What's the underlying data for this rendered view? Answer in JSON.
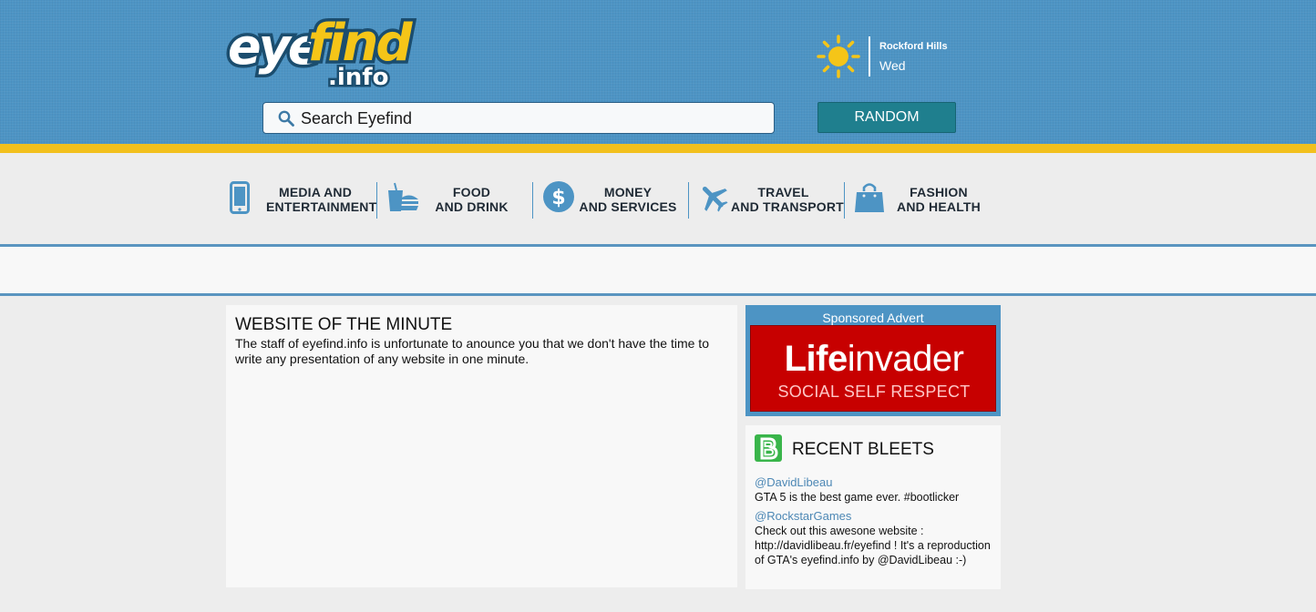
{
  "header": {
    "logo_alt": "eyefind.info",
    "weather": {
      "icon": "sun-icon",
      "city": "Rockford Hills",
      "day": "Wed"
    },
    "search": {
      "placeholder": "Search Eyefind",
      "value": ""
    },
    "random_label": "RANDOM"
  },
  "categories": [
    {
      "icon": "phone-icon",
      "line1": "MEDIA AND",
      "line2": "ENTERTAINMENT"
    },
    {
      "icon": "food-icon",
      "line1": "FOOD",
      "line2": "AND DRINK"
    },
    {
      "icon": "dollar-icon",
      "line1": "MONEY",
      "line2": "AND SERVICES"
    },
    {
      "icon": "plane-icon",
      "line1": "TRAVEL",
      "line2": "AND TRANSPORT"
    },
    {
      "icon": "shopping-bag-icon",
      "line1": "FASHION",
      "line2": "AND HEALTH"
    }
  ],
  "website_of_minute": {
    "title": "WEBSITE OF THE MINUTE",
    "text": "The staff of eyefind.info is unfortunate to anounce you that we don't have the time to write any presentation of any website in one minute."
  },
  "advert": {
    "label": "Sponsored Advert",
    "brand_bold": "Life",
    "brand_rest": "invader",
    "tagline": "SOCIAL SELF RESPECT"
  },
  "bleets": {
    "title": "RECENT BLEETS",
    "items": [
      {
        "user": "@DavidLibeau",
        "text": "GTA 5 is the best game ever. #bootlicker"
      },
      {
        "user": "@RockstarGames",
        "text": "Check out this awesone website : http://davidlibeau.fr/eyefind ! It's a reproduction of GTA's eyefind.info by @DavidLibeau :-)"
      }
    ]
  },
  "colors": {
    "header_blue": "#4d94c4",
    "accent_yellow": "#f2c01d",
    "random_teal": "#1f7f8e",
    "lifeinvader_red": "#c70000",
    "link_blue": "#4d88b5"
  }
}
